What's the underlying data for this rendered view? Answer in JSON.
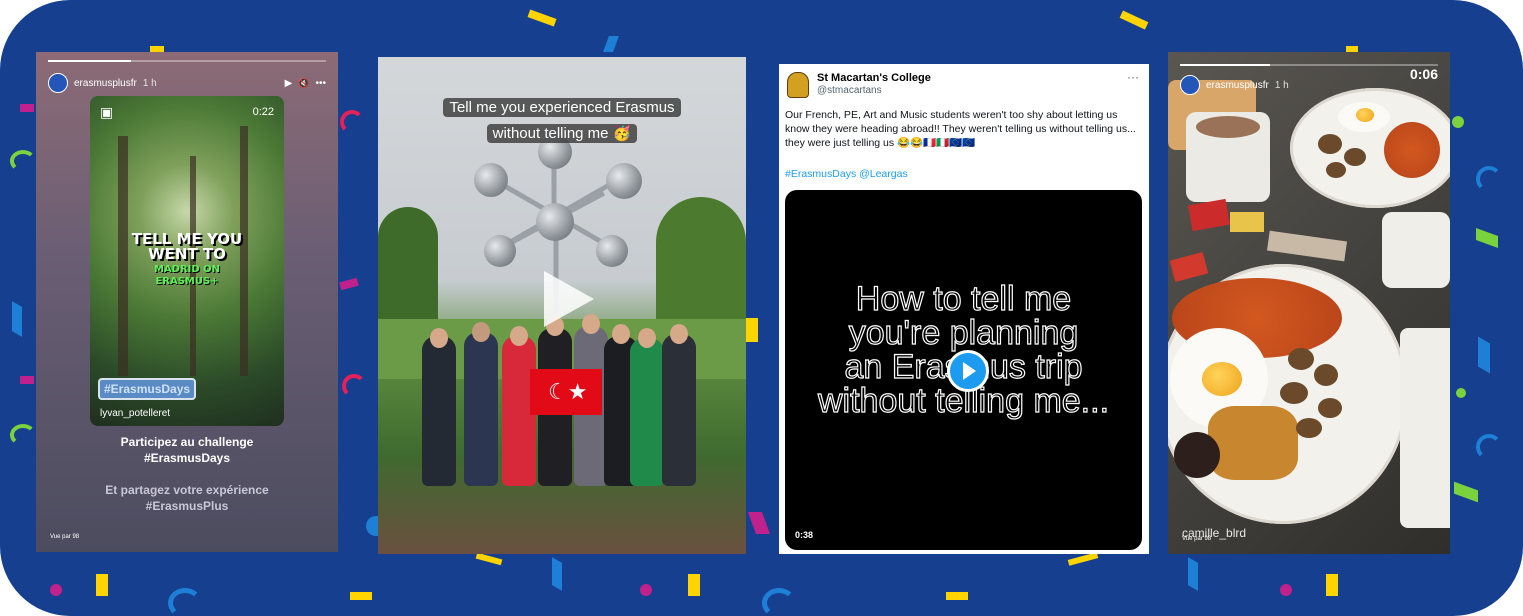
{
  "background": {
    "color": "#163f8f",
    "accents": [
      "#ffd400",
      "#e6205a",
      "#7ad33c",
      "#1e7fd6",
      "#c0218c"
    ]
  },
  "panel1": {
    "username": "erasmusplusfr",
    "age": "1 h",
    "controls": {
      "play": "▶",
      "mute": "🔇",
      "more": "•••"
    },
    "video_time": "0:22",
    "text_line1": "TELL ME YOU",
    "text_line2": "WENT TO",
    "text_line3": "MADRID ON",
    "text_line4": "ERASMUS+",
    "hashtag_sticker": "#ErasmusDays",
    "reel_user": "lyvan_potelleret",
    "caption_line1": "Participez au challenge",
    "caption_line2": "#ErasmusDays",
    "caption_line3": "Et partagez votre expérience",
    "caption_line4": "#ErasmusPlus",
    "viewed": "Vue par 98"
  },
  "panel2": {
    "caption_line1": "Tell me you experienced Erasmus",
    "caption_line2": "without telling me 🥳",
    "flag_symbol": "☾★"
  },
  "panel3": {
    "account_name": "St Macartan's College",
    "handle": "@stmacartans",
    "more": "···",
    "tweet_text": "Our French, PE, Art and Music students weren't too shy about letting us know they were heading abroad!! They weren't telling us without telling us... they were just telling us 😂😂🇫🇷🇮🇹🇪🇺🇪🇺",
    "hashtags": "#ErasmusDays @Leargas",
    "video_line1": "How to tell me",
    "video_line2": "you're planning",
    "video_line3": "an Erasmus trip",
    "video_line4": "without telling me...",
    "video_duration": "0:38"
  },
  "panel4": {
    "username": "erasmusplusfr",
    "age": "1 h",
    "counter": "0:06",
    "reel_user": "camille_blrd",
    "viewed": "Vue par 98"
  }
}
